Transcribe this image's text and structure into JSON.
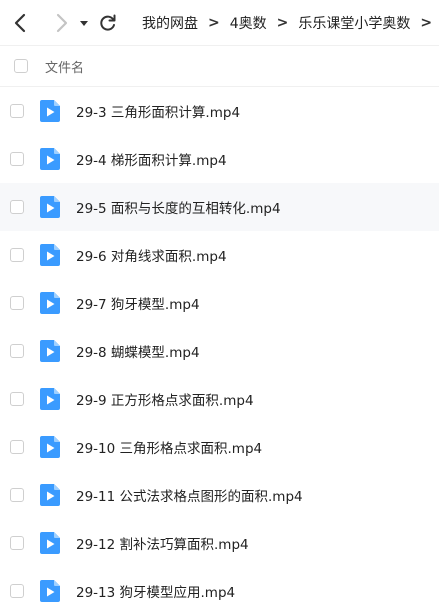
{
  "breadcrumb": [
    "我的网盘",
    "4奥数",
    "乐乐课堂小学奥数"
  ],
  "list_header": {
    "name_column": "文件名"
  },
  "files": [
    "29-3 三角形面积计算.mp4",
    "29-4 梯形面积计算.mp4",
    "29-5 面积与长度的互相转化.mp4",
    "29-6 对角线求面积.mp4",
    "29-7 狗牙模型.mp4",
    "29-8 蝴蝶模型.mp4",
    "29-9 正方形格点求面积.mp4",
    "29-10 三角形格点求面积.mp4",
    "29-11 公式法求格点图形的面积.mp4",
    "29-12 割补法巧算面积.mp4",
    "29-13 狗牙模型应用.mp4"
  ],
  "hovered_row_index": 2,
  "colors": {
    "video_icon": "#3a9bff",
    "hover_row": "#f7f8fa"
  },
  "icons": [
    "back-arrow-icon",
    "forward-arrow-icon",
    "dropdown-triangle-icon",
    "refresh-icon",
    "video-file-icon"
  ]
}
